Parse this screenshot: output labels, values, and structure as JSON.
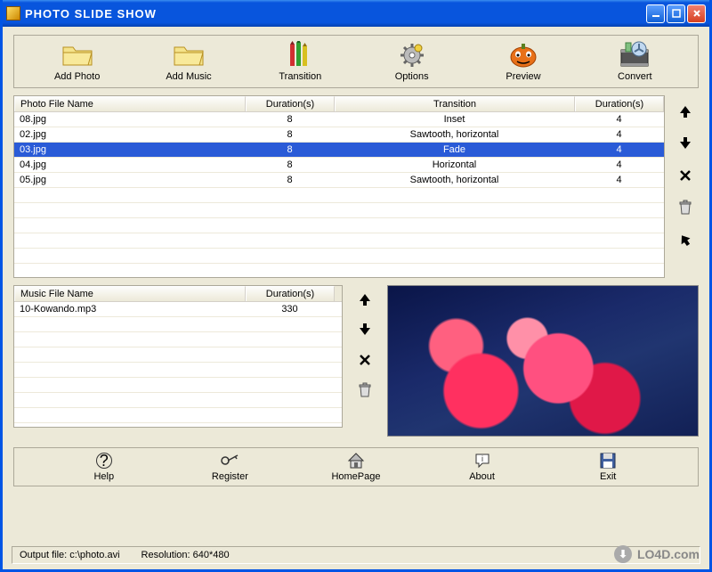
{
  "title": "PHOTO SLIDE SHOW",
  "toolbar": [
    {
      "label": "Add Photo",
      "icon": "folder"
    },
    {
      "label": "Add Music",
      "icon": "folder"
    },
    {
      "label": "Transition",
      "icon": "pencils"
    },
    {
      "label": "Options",
      "icon": "gear"
    },
    {
      "label": "Preview",
      "icon": "pumpkin"
    },
    {
      "label": "Convert",
      "icon": "film"
    }
  ],
  "photo_table": {
    "headers": [
      "Photo File Name",
      "Duration(s)",
      "Transition",
      "Duration(s)"
    ],
    "rows": [
      {
        "file": "08.jpg",
        "dur1": "8",
        "trans": "Inset",
        "dur2": "4",
        "sel": false
      },
      {
        "file": "02.jpg",
        "dur1": "8",
        "trans": "Sawtooth, horizontal",
        "dur2": "4",
        "sel": false
      },
      {
        "file": "03.jpg",
        "dur1": "8",
        "trans": "Fade",
        "dur2": "4",
        "sel": true
      },
      {
        "file": "04.jpg",
        "dur1": "8",
        "trans": "Horizontal",
        "dur2": "4",
        "sel": false
      },
      {
        "file": "05.jpg",
        "dur1": "8",
        "trans": "Sawtooth, horizontal",
        "dur2": "4",
        "sel": false
      }
    ],
    "empty_rows": 6
  },
  "photo_side_buttons": [
    "up",
    "down",
    "delete",
    "trash",
    "clear"
  ],
  "music_table": {
    "headers": [
      "Music File Name",
      "Duration(s)"
    ],
    "rows": [
      {
        "file": "10-Kowando.mp3",
        "dur": "330"
      }
    ],
    "empty_rows": 7
  },
  "music_side_buttons": [
    "up",
    "down",
    "delete",
    "trash"
  ],
  "footer_buttons": [
    {
      "label": "Help",
      "icon": "help"
    },
    {
      "label": "Register",
      "icon": "key"
    },
    {
      "label": "HomePage",
      "icon": "home"
    },
    {
      "label": "About",
      "icon": "about"
    },
    {
      "label": "Exit",
      "icon": "save"
    }
  ],
  "status": {
    "output_label": "Output file: ",
    "output_value": "c:\\photo.avi",
    "res_label": "Resolution: ",
    "res_value": "640*480"
  },
  "watermark": "LO4D.com"
}
